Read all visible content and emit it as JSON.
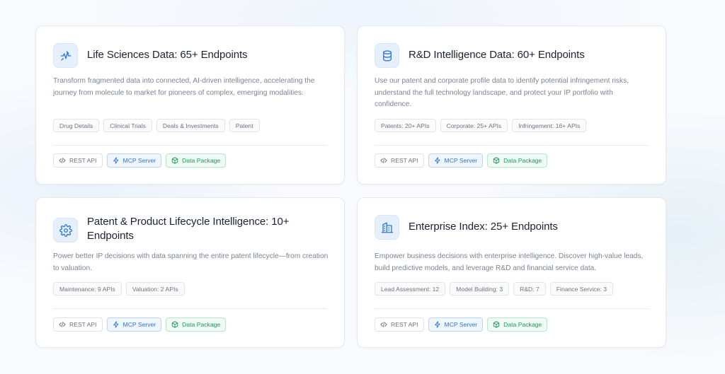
{
  "cards": [
    {
      "title": "Life Sciences Data: 65+ Endpoints",
      "icon": "pulse-icon",
      "description": "Transform fragmented data into connected, AI-driven intelligence, accelerating the journey from molecule to market for pioneers of complex, emerging modalities.",
      "tags": [
        "Drug Details",
        "Clinical Trials",
        "Deals & Investments",
        "Patent"
      ],
      "chips": [
        "REST API",
        "MCP Server",
        "Data Package"
      ]
    },
    {
      "title": "R&D Intelligence Data: 60+ Endpoints",
      "icon": "database-icon",
      "description": "Use our patent and corporate profile data to identify potential infringement risks, understand the full technology landscape, and protect your IP portfolio with confidence.",
      "tags": [
        "Patents: 20+ APIs",
        "Corporate: 25+ APIs",
        "Infringement: 16+ APIs"
      ],
      "chips": [
        "REST API",
        "MCP Server",
        "Data Package"
      ]
    },
    {
      "title": "Patent & Product Lifecycle Intelligence: 10+ Endpoints",
      "icon": "gear-icon",
      "description": "Power better IP decisions with data spanning the entire patent lifecycle—from creation to valuation.",
      "tags": [
        "Maintenance: 9 APIs",
        "Valuation: 2 APIs"
      ],
      "chips": [
        "REST API",
        "MCP Server",
        "Data Package"
      ]
    },
    {
      "title": "Enterprise Index: 25+ Endpoints",
      "icon": "building-icon",
      "description": "Empower business decisions with enterprise intelligence. Discover high-value leads, build predictive models, and leverage R&D and financial service data.",
      "tags": [
        "Lead Assessment: 12",
        "Model Building: 3",
        "R&D: 7",
        "Finance Service: 3"
      ],
      "chips": [
        "REST API",
        "MCP Server",
        "Data Package"
      ]
    }
  ],
  "colors": {
    "accent": "#2f78d2",
    "mcp_text": "#2f78d2",
    "package_text": "#1e9a5a",
    "title_text": "#1a2233",
    "body_text": "#7b8494"
  }
}
